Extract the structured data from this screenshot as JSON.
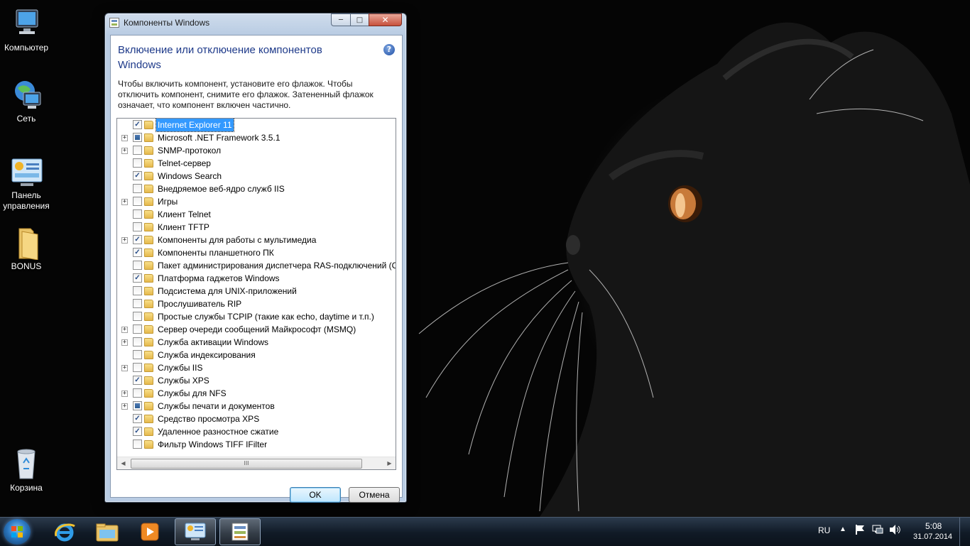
{
  "desktop": {
    "icons": [
      {
        "label": "Компьютер",
        "icon": "computer-icon"
      },
      {
        "label": "Сеть",
        "icon": "network-icon"
      },
      {
        "label": "Панель управления",
        "icon": "control-panel-icon"
      },
      {
        "label": "BONUS",
        "icon": "folder-icon"
      },
      {
        "label": "Корзина",
        "icon": "recycle-bin-icon"
      }
    ]
  },
  "dialog": {
    "title": "Компоненты Windows",
    "heading": "Включение или отключение компонентов Windows",
    "description": "Чтобы включить компонент, установите его флажок. Чтобы отключить компонент, снимите его флажок. Затененный флажок означает, что компонент включен частично.",
    "help_glyph": "?",
    "features": [
      {
        "label": "Internet Explorer 11",
        "state": "checked",
        "expandable": false,
        "selected": true
      },
      {
        "label": "Microsoft .NET Framework 3.5.1",
        "state": "partial",
        "expandable": true
      },
      {
        "label": "SNMP-протокол",
        "state": "unchecked",
        "expandable": true
      },
      {
        "label": "Telnet-сервер",
        "state": "unchecked",
        "expandable": false
      },
      {
        "label": "Windows Search",
        "state": "checked",
        "expandable": false
      },
      {
        "label": "Внедряемое веб-ядро служб IIS",
        "state": "unchecked",
        "expandable": false
      },
      {
        "label": "Игры",
        "state": "unchecked",
        "expandable": true
      },
      {
        "label": "Клиент Telnet",
        "state": "unchecked",
        "expandable": false
      },
      {
        "label": "Клиент TFTP",
        "state": "unchecked",
        "expandable": false
      },
      {
        "label": "Компоненты для работы с мультимедиа",
        "state": "checked",
        "expandable": true
      },
      {
        "label": "Компоненты планшетного ПК",
        "state": "checked",
        "expandable": false
      },
      {
        "label": "Пакет администрирования диспетчера RAS-подключений (C",
        "state": "unchecked",
        "expandable": false
      },
      {
        "label": "Платформа гаджетов Windows",
        "state": "checked",
        "expandable": false
      },
      {
        "label": "Подсистема для UNIX-приложений",
        "state": "unchecked",
        "expandable": false
      },
      {
        "label": "Прослушиватель RIP",
        "state": "unchecked",
        "expandable": false
      },
      {
        "label": "Простые службы TCPIP (такие как echo, daytime и т.п.)",
        "state": "unchecked",
        "expandable": false
      },
      {
        "label": "Сервер очереди сообщений Майкрософт (MSMQ)",
        "state": "unchecked",
        "expandable": true
      },
      {
        "label": "Служба активации Windows",
        "state": "unchecked",
        "expandable": true
      },
      {
        "label": "Служба индексирования",
        "state": "unchecked",
        "expandable": false
      },
      {
        "label": "Службы IIS",
        "state": "unchecked",
        "expandable": true
      },
      {
        "label": "Службы XPS",
        "state": "checked",
        "expandable": false
      },
      {
        "label": "Службы для NFS",
        "state": "unchecked",
        "expandable": true
      },
      {
        "label": "Службы печати и документов",
        "state": "partial",
        "expandable": true
      },
      {
        "label": "Средство просмотра XPS",
        "state": "checked",
        "expandable": false
      },
      {
        "label": "Удаленное разностное сжатие",
        "state": "checked",
        "expandable": false
      },
      {
        "label": "Фильтр Windows TIFF IFilter",
        "state": "unchecked",
        "expandable": false
      }
    ],
    "scroll_thumb_glyph": "III",
    "ok_label": "OK",
    "cancel_label": "Отмена"
  },
  "taskbar": {
    "pinned": [
      "internet-explorer-icon",
      "explorer-icon",
      "media-player-icon",
      "control-panel-icon",
      "windows-features-icon"
    ],
    "language": "RU",
    "time": "5:08",
    "date": "31.07.2014"
  },
  "colors": {
    "accent": "#1e3a8a",
    "selection": "#3399ff"
  }
}
